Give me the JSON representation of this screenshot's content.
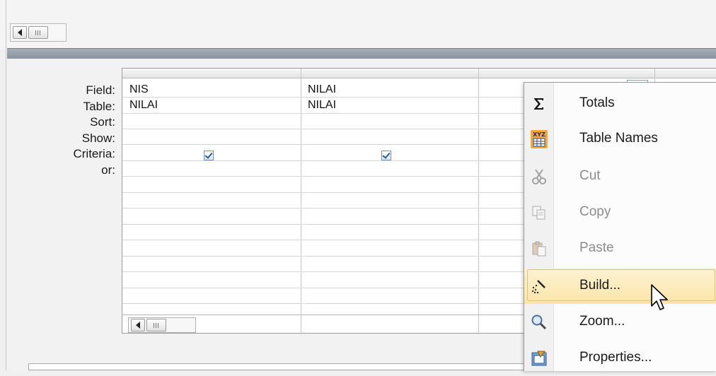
{
  "grid": {
    "row_labels": [
      "Field:",
      "Table:",
      "Sort:",
      "Show:",
      "Criteria:",
      "or:"
    ],
    "columns": [
      {
        "field": "NIS",
        "table": "NILAI",
        "show": true
      },
      {
        "field": "NILAI",
        "table": "NILAI",
        "show": true
      }
    ]
  },
  "context_menu": {
    "items": [
      {
        "name": "totals",
        "label": "Totals",
        "icon": "sigma-icon",
        "enabled": true
      },
      {
        "name": "table-names",
        "label": "Table Names",
        "icon": "table-names-icon",
        "enabled": true
      },
      {
        "name": "cut",
        "label": "Cut",
        "icon": "scissors-icon",
        "enabled": false
      },
      {
        "name": "copy",
        "label": "Copy",
        "icon": "copy-icon",
        "enabled": false
      },
      {
        "name": "paste",
        "label": "Paste",
        "icon": "paste-icon",
        "enabled": false
      },
      {
        "name": "build",
        "label": "Build...",
        "icon": "build-wand-icon",
        "enabled": true,
        "hovered": true
      },
      {
        "name": "zoom",
        "label": "Zoom...",
        "icon": "magnifier-icon",
        "enabled": true
      },
      {
        "name": "properties",
        "label": "Properties...",
        "icon": "properties-icon",
        "enabled": true
      }
    ]
  },
  "colors": {
    "hover_bg": "#fbe5a8",
    "hover_border": "#e5c365",
    "splitter": "#8a939e",
    "check": "#2a5aa0"
  }
}
